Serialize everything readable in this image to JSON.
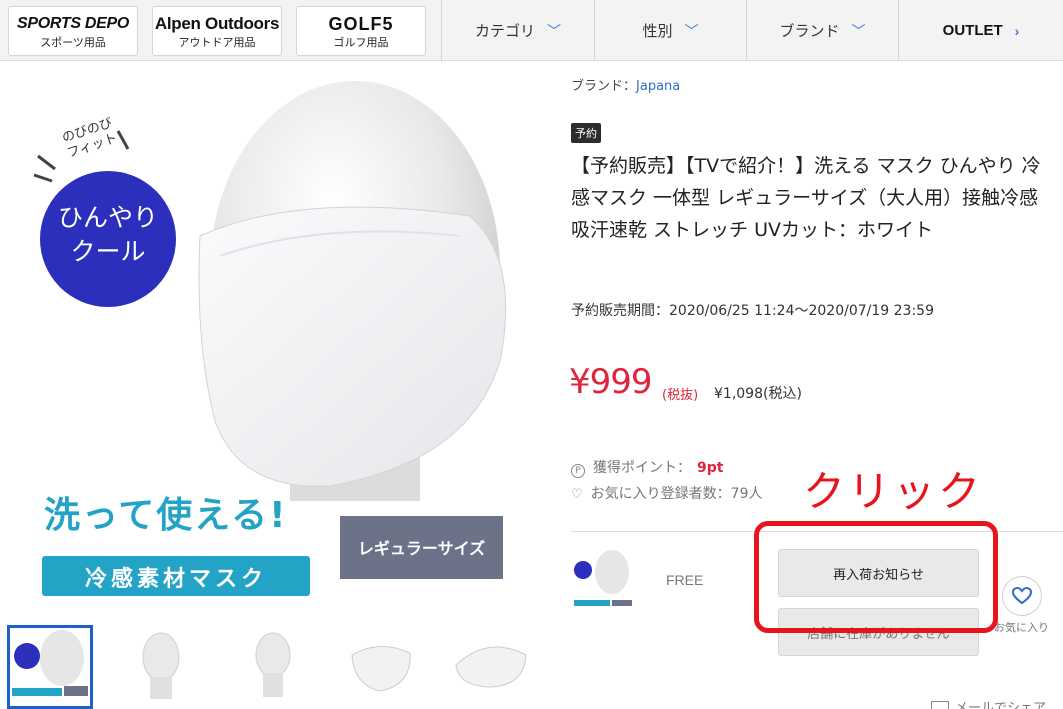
{
  "header": {
    "stores": [
      {
        "name": "SPORTS DEPO",
        "sub": "スポーツ用品"
      },
      {
        "name": "Alpen Outdoors",
        "sub": "アウトドア用品"
      },
      {
        "name": "GOLF5",
        "sub": "ゴルフ用品"
      }
    ],
    "nav": [
      {
        "label": "カテゴリ",
        "icon": "chevron-down-icon"
      },
      {
        "label": "性別",
        "icon": "chevron-down-icon"
      },
      {
        "label": "ブランド",
        "icon": "chevron-down-icon"
      },
      {
        "label": "OUTLET",
        "icon": "chevron-right-icon"
      }
    ]
  },
  "main_image": {
    "badge_top": "のびのび",
    "badge_top2": "フィット",
    "circle_line1": "ひんやり",
    "circle_line2": "クール",
    "headline": "洗って使える!",
    "banner": "冷感素材マスク",
    "size_tag": "レギュラーサイズ"
  },
  "thumbnails": {
    "count": 5,
    "selected_index": 0
  },
  "product": {
    "brand_label": "ブランド：",
    "brand_name": "Japana",
    "badge": "予約",
    "title": "【予約販売】【TVで紹介！】洗える マスク ひんやり 冷感マスク 一体型 レギュラーサイズ（大人用）接触冷感 吸汗速乾 ストレッチ UVカット：ホワイト",
    "period": "予約販売期間：2020/06/25 11:24〜2020/07/19 23:59",
    "price": "¥999",
    "tax_ex_label": "(税抜)",
    "tax_in": "¥1,098(税込)",
    "points_label": "獲得ポイント：",
    "points_value": "9pt",
    "fav_count": "お気に入り登録者数：79人"
  },
  "variant": {
    "size": "FREE",
    "restock_button": "再入荷お知らせ",
    "store_button": "店舗に在庫がありません",
    "fav_label": "お気に入り",
    "mail_share": "メールでシェア"
  },
  "annotation": {
    "text": "クリック"
  },
  "colors": {
    "price_red": "#e0243c",
    "annotation_red": "#e8141c",
    "link_blue": "#2f6fc9",
    "accent_blue": "#3a7bd5"
  }
}
